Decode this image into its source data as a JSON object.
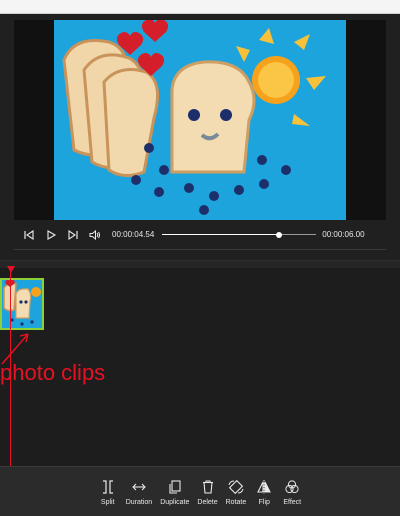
{
  "player": {
    "current_time": "00:00:04.54",
    "total_time": "00:00:06.00",
    "progress_fraction": 0.757
  },
  "icons": {
    "previous_frame": "skip-back-icon",
    "play": "play-icon",
    "next_frame": "skip-forward-icon",
    "volume": "speaker-icon"
  },
  "timeline": {
    "annotation": "photo clips"
  },
  "toolbar": {
    "items": [
      {
        "label": "Split",
        "icon": "split-icon"
      },
      {
        "label": "Duration",
        "icon": "duration-icon"
      },
      {
        "label": "Duplicate",
        "icon": "duplicate-icon"
      },
      {
        "label": "Delete",
        "icon": "trash-icon"
      },
      {
        "label": "Rotate",
        "icon": "rotate-icon"
      },
      {
        "label": "Flip",
        "icon": "flip-icon"
      },
      {
        "label": "Effect",
        "icon": "effect-icon"
      }
    ]
  },
  "colors": {
    "accent_red": "#e81123",
    "clip_border": "#8dd13a",
    "background": "#1f1f1f",
    "toolbar_bg": "#2b2b2b"
  }
}
